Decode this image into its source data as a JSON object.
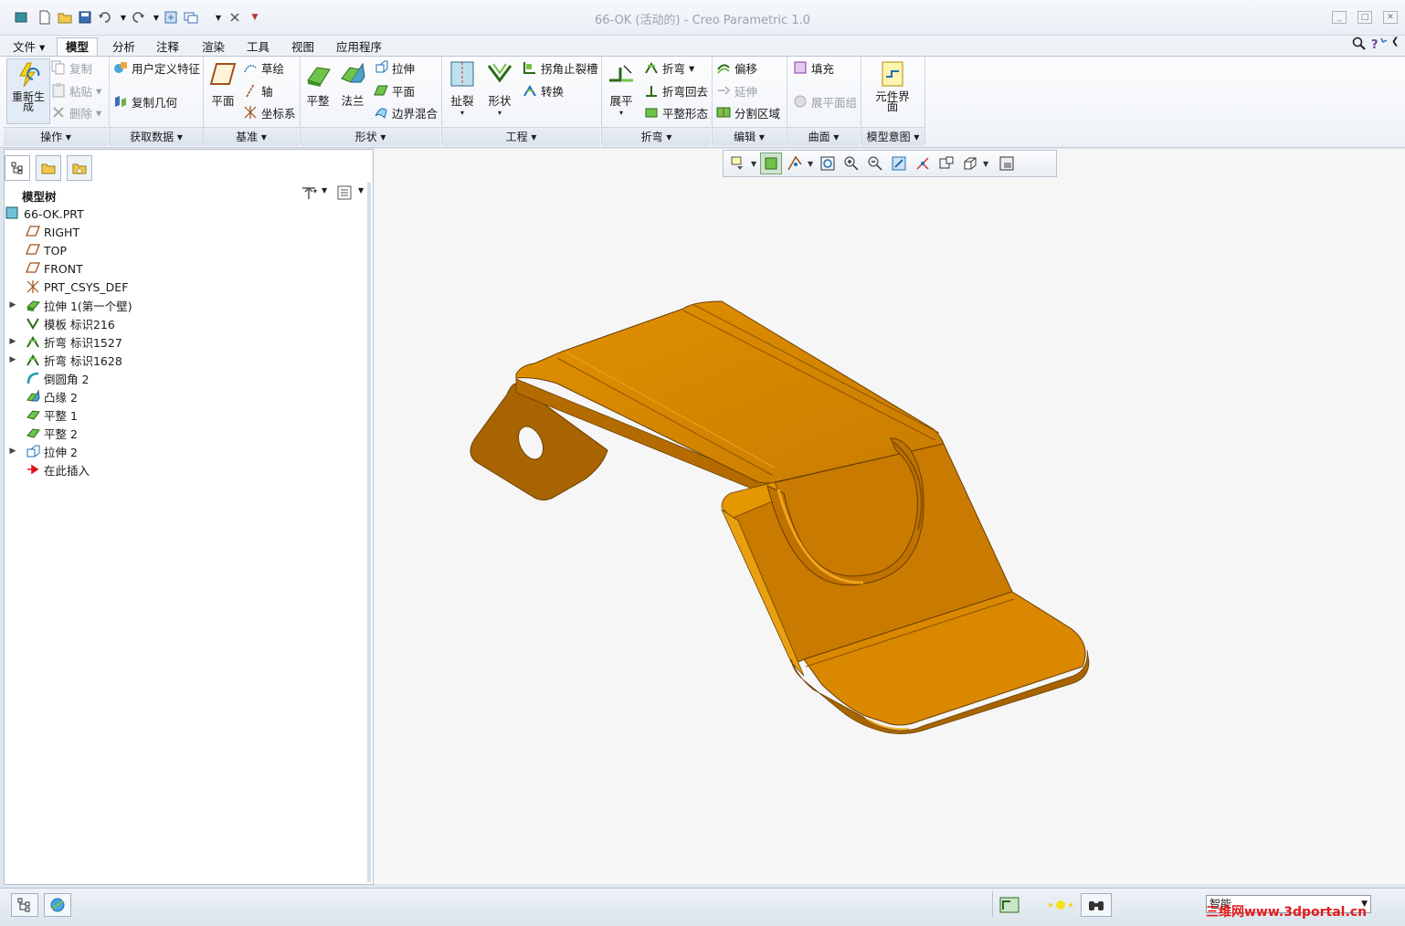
{
  "window": {
    "title": "66-OK (活动的) - Creo Parametric 1.0"
  },
  "menu": {
    "file": "文件"
  },
  "tabs": [
    "模型",
    "分析",
    "注释",
    "渲染",
    "工具",
    "视图",
    "应用程序"
  ],
  "ribbon": {
    "operations": {
      "regenerate": "重新生成",
      "copy": "复制",
      "paste": "粘贴",
      "delete": "删除",
      "label": "操作"
    },
    "get_data": {
      "udf": "用户定义特征",
      "copy_geom": "复制几何",
      "label": "获取数据"
    },
    "datum": {
      "plane": "平面",
      "sketch": "草绘",
      "axis": "轴",
      "csys": "坐标系",
      "label": "基准"
    },
    "shapes": {
      "flat": "平整",
      "flange": "法兰",
      "extrude": "拉伸",
      "planar": "平面",
      "boundary_blend": "边界混合",
      "label": "形状"
    },
    "engineering": {
      "rip": "扯裂",
      "form": "形状",
      "corner_relief": "拐角止裂槽",
      "convert": "转换",
      "label": "工程"
    },
    "bends": {
      "unbend": "展平",
      "bend": "折弯",
      "bend_back": "折弯回去",
      "flat_state": "平整形态",
      "label": "折弯"
    },
    "editing": {
      "offset": "偏移",
      "extend": "延伸",
      "split_area": "分割区域",
      "label": "编辑"
    },
    "surfaces": {
      "fill": "填充",
      "flatten_quilt": "展平面组",
      "label": "曲面"
    },
    "model_intent": {
      "component_interface": "元件界面",
      "label": "模型意图"
    }
  },
  "model_tree": {
    "header": "模型树",
    "items": [
      {
        "label": "66-OK.PRT",
        "icon": "part-icon",
        "expand": ""
      },
      {
        "label": "RIGHT",
        "icon": "datum-plane-icon",
        "expand": ""
      },
      {
        "label": "TOP",
        "icon": "datum-plane-icon",
        "expand": ""
      },
      {
        "label": "FRONT",
        "icon": "datum-plane-icon",
        "expand": ""
      },
      {
        "label": "PRT_CSYS_DEF",
        "icon": "csys-icon",
        "expand": ""
      },
      {
        "label": "拉伸 1(第一个壁)",
        "icon": "extrude-wall-icon",
        "expand": "▶"
      },
      {
        "label": "模板 标识216",
        "icon": "form-icon",
        "expand": ""
      },
      {
        "label": "折弯 标识1527",
        "icon": "bend-icon",
        "expand": "▶"
      },
      {
        "label": "折弯 标识1628",
        "icon": "bend-icon",
        "expand": "▶"
      },
      {
        "label": "倒圆角 2",
        "icon": "round-icon",
        "expand": ""
      },
      {
        "label": "凸缘 2",
        "icon": "flange-icon",
        "expand": ""
      },
      {
        "label": "平整 1",
        "icon": "flat-wall-icon",
        "expand": ""
      },
      {
        "label": "平整 2",
        "icon": "flat-wall-icon",
        "expand": ""
      },
      {
        "label": "拉伸 2",
        "icon": "extrude-icon",
        "expand": "▶"
      },
      {
        "label": "在此插入",
        "icon": "insert-here-icon",
        "expand": ""
      }
    ]
  },
  "status": {
    "filter": "智能",
    "watermark": "三维网www.3dportal.cn"
  },
  "colors": {
    "model": "#d98500",
    "model_dark": "#a85f00",
    "model_edge": "#7a4700",
    "accent": "#1f6fb5"
  }
}
